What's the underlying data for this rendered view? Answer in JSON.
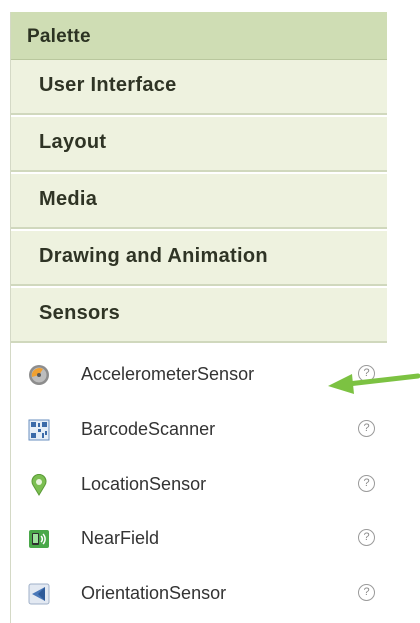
{
  "palette": {
    "title": "Palette",
    "categories": [
      {
        "label": "User Interface"
      },
      {
        "label": "Layout"
      },
      {
        "label": "Media"
      },
      {
        "label": "Drawing and Animation"
      },
      {
        "label": "Sensors"
      }
    ],
    "sensor_items": [
      {
        "label": "AccelerometerSensor",
        "icon": "accelerometer-icon",
        "help": "?"
      },
      {
        "label": "BarcodeScanner",
        "icon": "barcode-scanner-icon",
        "help": "?"
      },
      {
        "label": "LocationSensor",
        "icon": "location-pin-icon",
        "help": "?"
      },
      {
        "label": "NearField",
        "icon": "nfc-icon",
        "help": "?"
      },
      {
        "label": "OrientationSensor",
        "icon": "orientation-icon",
        "help": "?"
      }
    ]
  },
  "colors": {
    "header_bg": "#cfddb4",
    "category_bg": "#eef2df",
    "arrow": "#7cc242"
  }
}
